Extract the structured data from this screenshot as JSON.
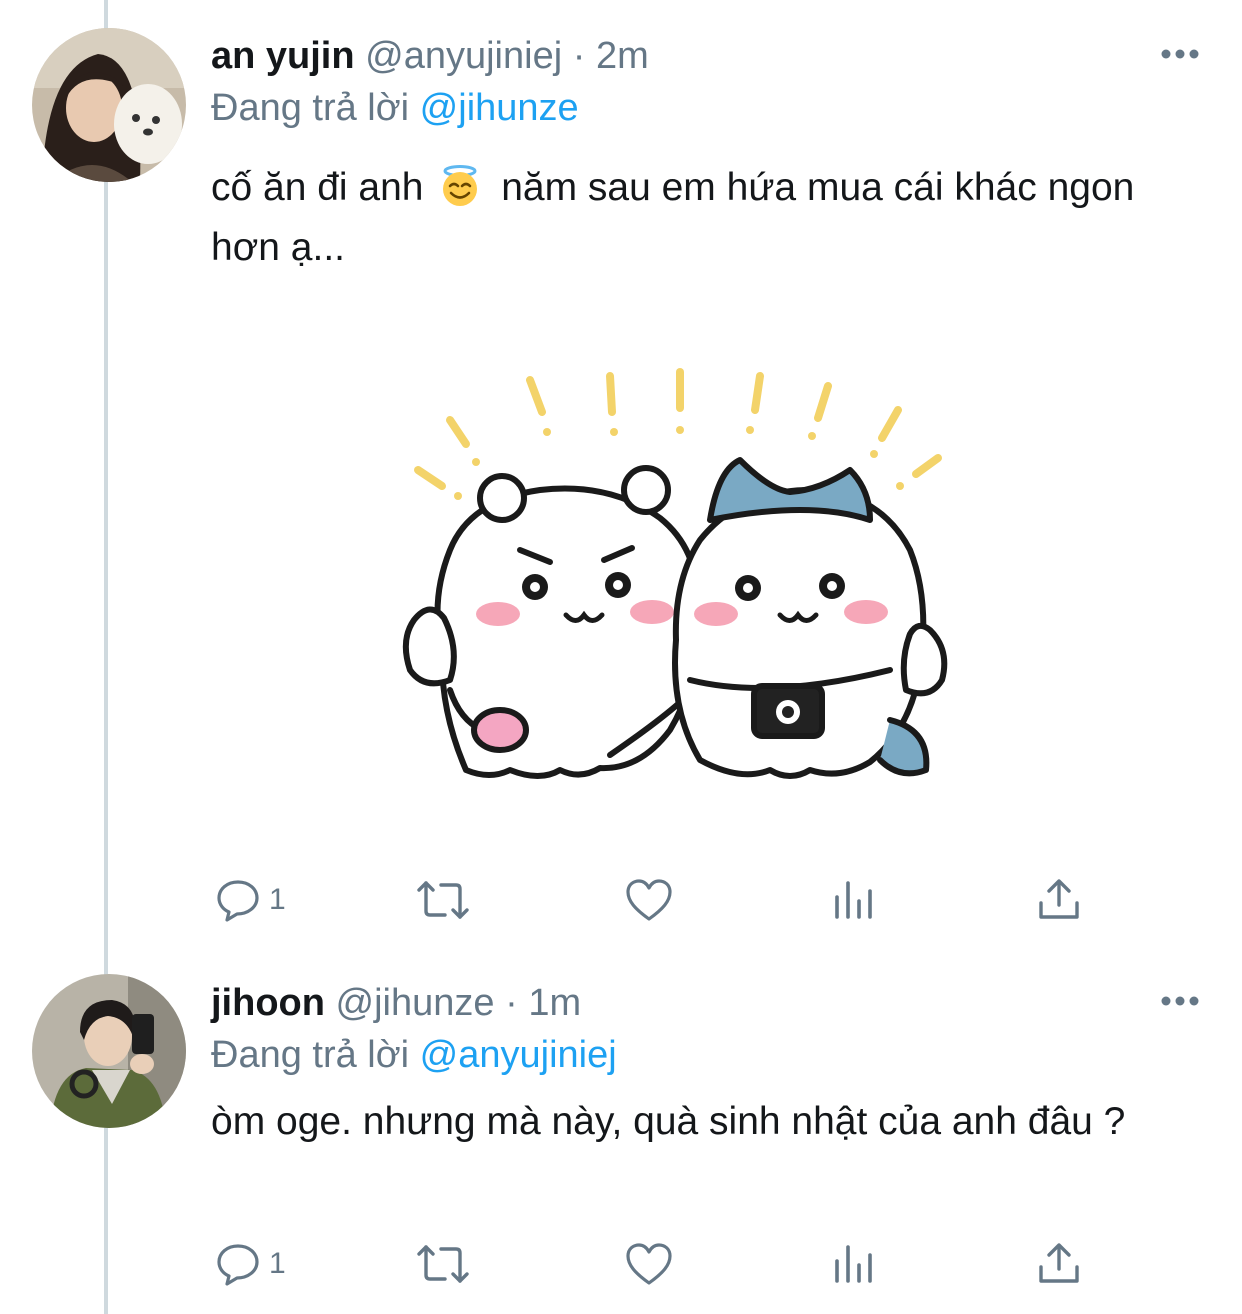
{
  "colors": {
    "link": "#1da1f2",
    "secondary": "#657786",
    "text": "#14171a",
    "thread_line": "#cfd9de"
  },
  "tweets": [
    {
      "name": "an yujin",
      "handle": "@anyujiniej",
      "separator": "·",
      "time": "2m",
      "reply_prefix": "Đang trả lời",
      "reply_to": "@jihunze",
      "text_before_emoji": "cố ăn đi anh",
      "emoji": "smiling-face-with-halo",
      "text_after_emoji": "năm sau em hứa mua cái khác ngon hơn ạ...",
      "has_image": true,
      "reply_count": "1"
    },
    {
      "name": "jihoon",
      "handle": "@jihunze",
      "separator": "·",
      "time": "1m",
      "reply_prefix": "Đang trả lời",
      "reply_to": "@anyujiniej",
      "text": "òm oge. nhưng mà này, quà sinh nhật của anh đâu ?",
      "reply_count": "1"
    }
  ]
}
